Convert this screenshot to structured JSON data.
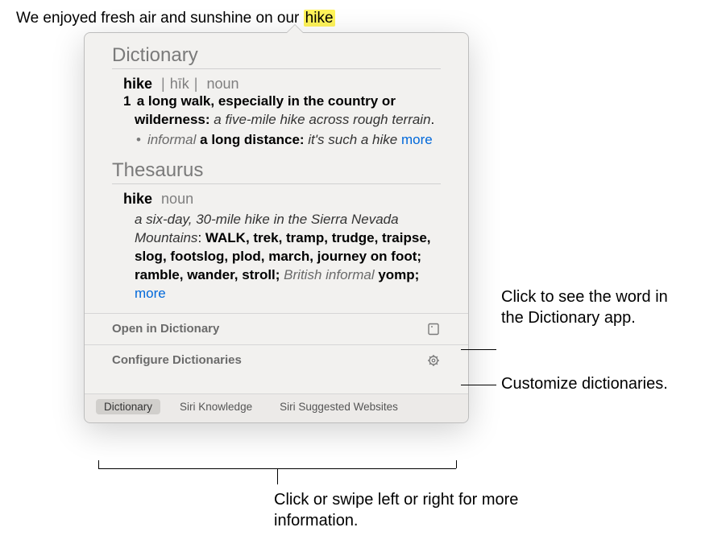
{
  "sentence": {
    "prefix": "We enjoyed fresh air and sunshine on our ",
    "highlighted": "hike"
  },
  "popover": {
    "dictionary": {
      "section_title": "Dictionary",
      "headword": "hike",
      "pronunciation_bar": "|",
      "pronunciation": "hīk",
      "pos": "noun",
      "def_num": "1",
      "def_text": "a long walk, especially in the country or wilderness: ",
      "example": "a five-mile hike across rough terrain",
      "period": ".",
      "sub_label": "informal",
      "sub_def": " a long distance: ",
      "sub_example": "it's such a hike ",
      "more": "more"
    },
    "thesaurus": {
      "section_title": "Thesaurus",
      "headword": "hike",
      "pos": "noun",
      "example_prefix": "a six-day, 30-mile hike in the Sierra Nevada Mountains",
      "colon": ": ",
      "syn_primary": "WALK",
      "syn_rest": ", trek, tramp, trudge, traipse, slog, footslog, plod, march, journey on foot; ramble, wander, stroll; ",
      "syn_label": "British informal",
      "syn_tail": " yomp; ",
      "more": "more"
    },
    "actions": {
      "open": "Open in Dictionary",
      "configure": "Configure Dictionaries"
    },
    "tabs": {
      "dictionary": "Dictionary",
      "siri_knowledge": "Siri Knowledge",
      "siri_websites": "Siri Suggested Websites"
    }
  },
  "callouts": {
    "open_app": "Click to see the word in the Dictionary app.",
    "customize": "Customize dictionaries.",
    "tabs_hint": "Click or swipe left or right for more information."
  }
}
